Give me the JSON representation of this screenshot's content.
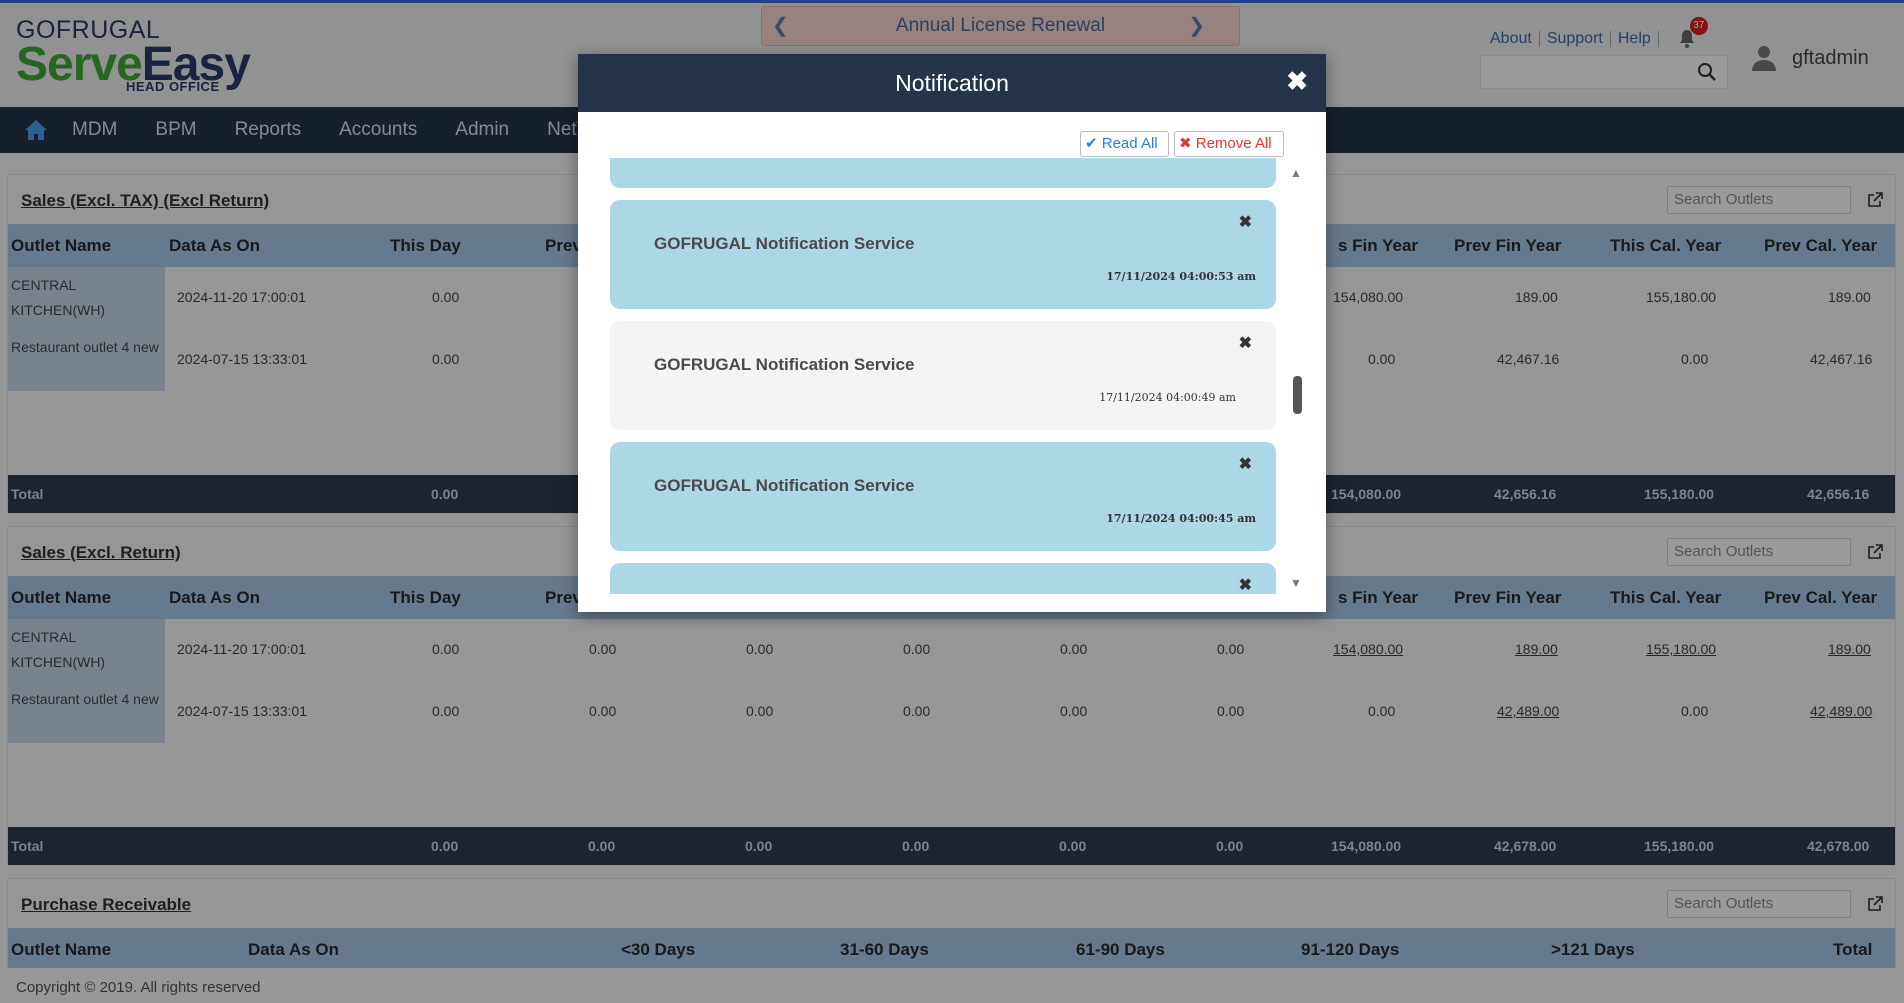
{
  "brand": {
    "top": "GOFRUGAL",
    "main_green": "Serve",
    "main_blue": "Easy",
    "sub": "HEAD OFFICE"
  },
  "license_banner": {
    "text": "Annual License Renewal"
  },
  "top_links": {
    "about": "About",
    "support": "Support",
    "help": "Help",
    "notification_count": "37"
  },
  "user": {
    "name": "gftadmin"
  },
  "nav": [
    "MDM",
    "BPM",
    "Reports",
    "Accounts",
    "Admin",
    "NetTr"
  ],
  "panels": [
    {
      "title": "Sales (Excl. TAX) (Excl Return)",
      "search_placeholder": "Search Outlets",
      "headers": [
        "Outlet Name",
        "Data As On",
        "This Day",
        "Prev",
        "s Fin Year",
        "Prev Fin Year",
        "This Cal. Year",
        "Prev Cal. Year"
      ],
      "rows": [
        {
          "name": "CENTRAL KITCHEN(WH)",
          "date": "2024-11-20 17:00:01",
          "this_day": "0.00",
          "fin": "154,080.00",
          "prev_fin": "189.00",
          "cal": "155,180.00",
          "prev_cal": "189.00"
        },
        {
          "name": "Restaurant outlet 4 new",
          "date": "2024-07-15 13:33:01",
          "this_day": "0.00",
          "fin": "0.00",
          "prev_fin": "42,467.16",
          "cal": "0.00",
          "prev_cal": "42,467.16"
        }
      ],
      "total": {
        "label": "Total",
        "this_day": "0.00",
        "fin": "154,080.00",
        "prev_fin": "42,656.16",
        "cal": "155,180.00",
        "prev_cal": "42,656.16"
      }
    },
    {
      "title": "Sales (Excl. Return)",
      "search_placeholder": "Search Outlets",
      "headers": [
        "Outlet Name",
        "Data As On",
        "This Day",
        "Prev",
        "s Fin Year",
        "Prev Fin Year",
        "This Cal. Year",
        "Prev Cal. Year"
      ],
      "rows": [
        {
          "name": "CENTRAL KITCHEN(WH)",
          "date": "2024-11-20 17:00:01",
          "this_day": "0.00",
          "c4": "0.00",
          "c5": "0.00",
          "c6": "0.00",
          "c7": "0.00",
          "c8": "0.00",
          "fin": "154,080.00",
          "prev_fin": "189.00",
          "cal": "155,180.00",
          "prev_cal": "189.00"
        },
        {
          "name": "Restaurant outlet 4 new",
          "date": "2024-07-15 13:33:01",
          "this_day": "0.00",
          "c4": "0.00",
          "c5": "0.00",
          "c6": "0.00",
          "c7": "0.00",
          "c8": "0.00",
          "fin": "0.00",
          "prev_fin": "42,489.00",
          "cal": "0.00",
          "prev_cal": "42,489.00"
        }
      ],
      "total": {
        "label": "Total",
        "this_day": "0.00",
        "c4": "0.00",
        "c5": "0.00",
        "c6": "0.00",
        "c7": "0.00",
        "c8": "0.00",
        "fin": "154,080.00",
        "prev_fin": "42,678.00",
        "cal": "155,180.00",
        "prev_cal": "42,678.00"
      }
    },
    {
      "title": "Purchase Receivable",
      "search_placeholder": "Search Outlets",
      "headers": [
        "Outlet Name",
        "Data As On",
        "<30 Days",
        "31-60 Days",
        "61-90 Days",
        "91-120 Days",
        ">121 Days",
        "Total"
      ]
    }
  ],
  "footer": {
    "copyright": "Copyright © 2019. All rights reserved"
  },
  "modal": {
    "title": "Notification",
    "read_all": "Read All",
    "remove_all": "Remove All",
    "notifications": [
      {
        "title": "GOFRUGAL Notification Service",
        "time": "17/11/2024 04:00:53 am"
      },
      {
        "title": "GOFRUGAL Notification Service",
        "time": "17/11/2024 04:00:49 am"
      },
      {
        "title": "GOFRUGAL Notification Service",
        "time": "17/11/2024 04:00:45 am"
      }
    ]
  }
}
